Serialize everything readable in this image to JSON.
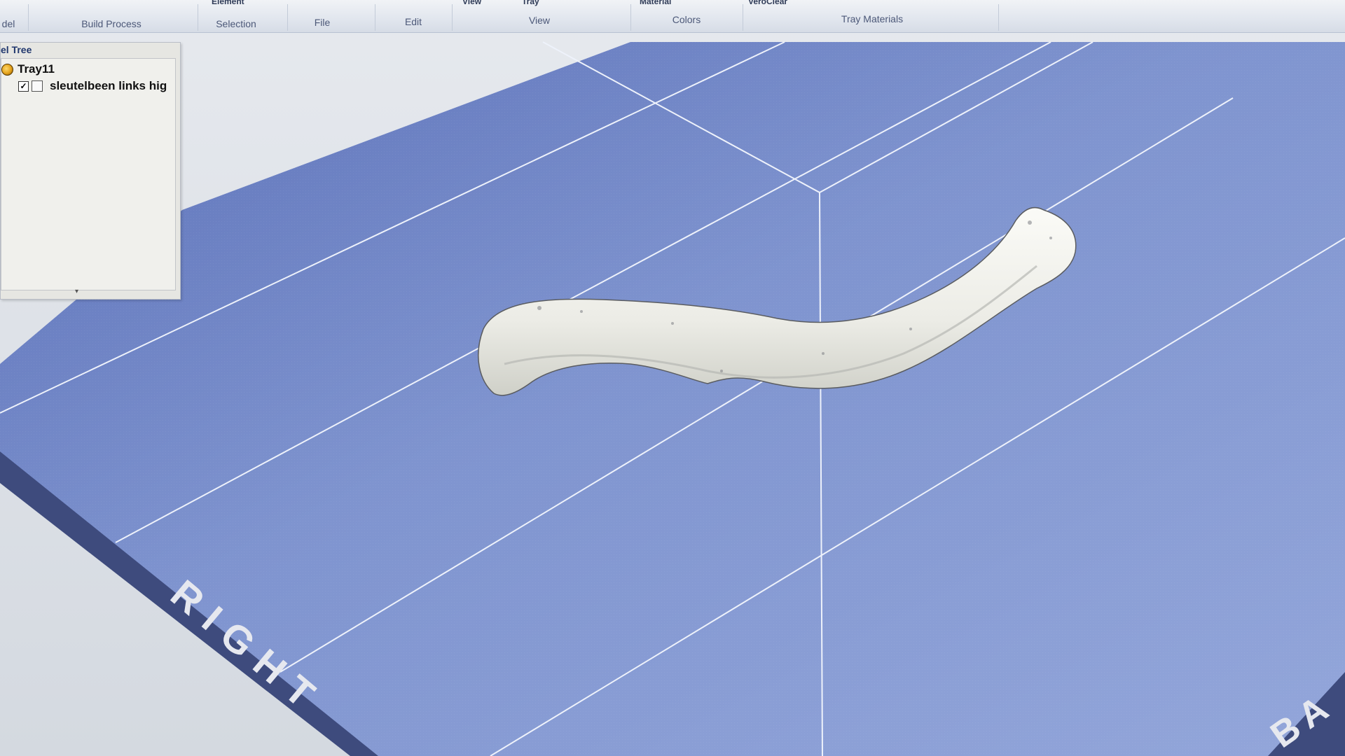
{
  "ribbon": {
    "top_labels": [
      "Element",
      "View",
      "Tray",
      "Material",
      "VeroClear"
    ],
    "groups": [
      "del",
      "Build Process",
      "Selection",
      "File",
      "Edit",
      "View",
      "Colors",
      "Tray Materials"
    ]
  },
  "model_tree": {
    "title": "el Tree",
    "tray": {
      "label": "Tray11"
    },
    "model": {
      "label": "sleutelbeen links hig",
      "checked": "✓"
    },
    "scroll_arrow": "▾"
  },
  "viewport": {
    "tray_edge_text_left": "RIGHT",
    "tray_edge_text_right": "BA",
    "colors": {
      "tray": "#6f86c4",
      "grid": "#e9eef8",
      "model": "#f2f2ee",
      "tray_edge": "#3d4a78"
    }
  }
}
